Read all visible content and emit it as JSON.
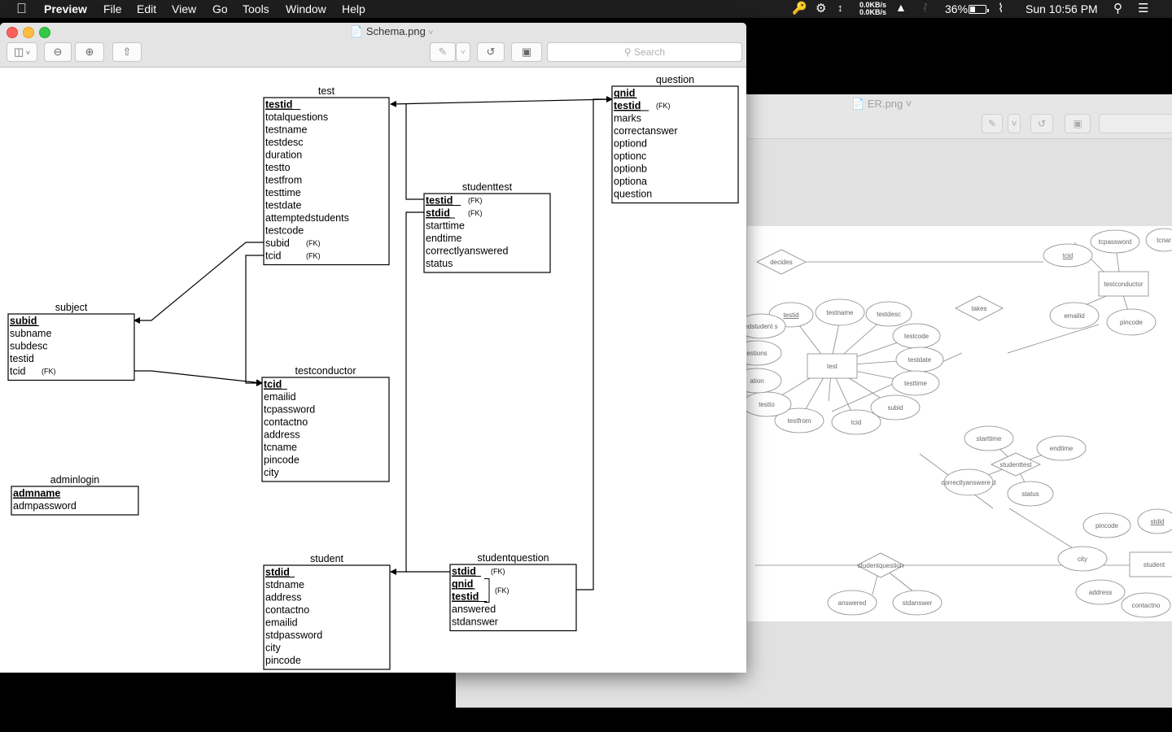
{
  "menubar": {
    "app_name": "Preview",
    "menus": [
      "File",
      "Edit",
      "View",
      "Go",
      "Tools",
      "Window",
      "Help"
    ],
    "net_up": "0.0KB/s",
    "net_down": "0.0KB/s",
    "battery": "36%",
    "clock": "Sun 10:56 PM"
  },
  "front_window": {
    "title": "Schema.png",
    "search_placeholder": "Search"
  },
  "back_window": {
    "title": "ER.png"
  },
  "schema": {
    "tables": [
      {
        "id": "test",
        "title": "test",
        "rows": [
          {
            "t": "testid",
            "k": true
          },
          {
            "t": "totalquestions"
          },
          {
            "t": "testname"
          },
          {
            "t": "testdesc"
          },
          {
            "t": "duration"
          },
          {
            "t": "testto"
          },
          {
            "t": "testfrom"
          },
          {
            "t": "testtime"
          },
          {
            "t": "testdate"
          },
          {
            "t": "attemptedstudents"
          },
          {
            "t": "testcode"
          },
          {
            "t": "subid",
            "fk": "(FK)"
          },
          {
            "t": "tcid",
            "fk": "(FK)"
          }
        ]
      },
      {
        "id": "question",
        "title": "question",
        "rows": [
          {
            "t": "qnid",
            "k": true
          },
          {
            "t": "testid",
            "k": true,
            "fk": "(FK)"
          },
          {
            "t": "marks"
          },
          {
            "t": "correctanswer"
          },
          {
            "t": "optiond"
          },
          {
            "t": "optionc"
          },
          {
            "t": "optionb"
          },
          {
            "t": "optiona"
          },
          {
            "t": "question"
          }
        ]
      },
      {
        "id": "studenttest",
        "title": "studenttest",
        "rows": [
          {
            "t": "testid",
            "k": true,
            "fk": "(FK)"
          },
          {
            "t": "stdid",
            "k": true,
            "fk": "(FK)"
          },
          {
            "t": "starttime"
          },
          {
            "t": "endtime"
          },
          {
            "t": "correctlyanswered"
          },
          {
            "t": "status"
          }
        ]
      },
      {
        "id": "subject",
        "title": "subject",
        "rows": [
          {
            "t": "subid",
            "k": true
          },
          {
            "t": "subname"
          },
          {
            "t": "subdesc"
          },
          {
            "t": "testid"
          },
          {
            "t": "tcid",
            "fk": "(FK)"
          }
        ]
      },
      {
        "id": "testconductor",
        "title": "testconductor",
        "rows": [
          {
            "t": "tcid",
            "k": true
          },
          {
            "t": "emailid"
          },
          {
            "t": "tcpassword"
          },
          {
            "t": "contactno"
          },
          {
            "t": "address"
          },
          {
            "t": "tcname"
          },
          {
            "t": "pincode"
          },
          {
            "t": "city"
          }
        ]
      },
      {
        "id": "adminlogin",
        "title": "adminlogin",
        "rows": [
          {
            "t": "admname",
            "k": true
          },
          {
            "t": "admpassword"
          }
        ]
      },
      {
        "id": "student",
        "title": "student",
        "rows": [
          {
            "t": "stdid",
            "k": true
          },
          {
            "t": "stdname"
          },
          {
            "t": "address"
          },
          {
            "t": "contactno"
          },
          {
            "t": "emailid"
          },
          {
            "t": "stdpassword"
          },
          {
            "t": "city"
          },
          {
            "t": "pincode"
          }
        ]
      },
      {
        "id": "studentquestion",
        "title": "studentquestion",
        "rows": [
          {
            "t": "stdid",
            "k": true,
            "fk": "(FK)"
          },
          {
            "t": "qnid",
            "k": true
          },
          {
            "t": "testid",
            "k": true
          },
          {
            "t": "answered"
          },
          {
            "t": "stdanswer"
          }
        ],
        "group_fk": "(FK)"
      }
    ]
  },
  "er": {
    "entities": [
      "testconductor",
      "test",
      "student"
    ],
    "relationships": [
      "decides",
      "takes",
      "studenttest",
      "studentquestion"
    ],
    "attributes": [
      "tcpassword",
      "tcnar",
      "tcid",
      "emailid",
      "pincode",
      "testid",
      "testname",
      "testdesc",
      "testcode",
      "testdate",
      "testtime",
      "subid",
      "tcid",
      "testfrom",
      "testto",
      "ation",
      "estions",
      "edstudent s",
      "starttime",
      "endtime",
      "correctlyanswere d",
      "status",
      "pincode",
      "stdid",
      "city",
      "address",
      "contactno",
      "answered",
      "stdanswer"
    ]
  }
}
